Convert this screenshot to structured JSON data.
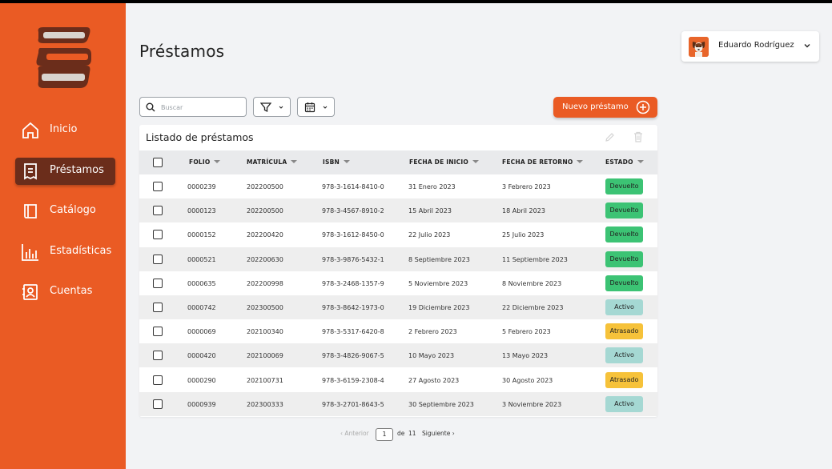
{
  "nav": {
    "items": [
      {
        "label": "Inicio",
        "icon": "home-icon"
      },
      {
        "label": "Préstamos",
        "icon": "receipt-icon",
        "active": true
      },
      {
        "label": "Catálogo",
        "icon": "book-icon"
      },
      {
        "label": "Estadísticas",
        "icon": "bar-chart-icon"
      },
      {
        "label": "Cuentas",
        "icon": "contact-card-icon"
      }
    ]
  },
  "header": {
    "title": "Préstamos"
  },
  "user": {
    "name": "Eduardo Rodríguez"
  },
  "toolbar": {
    "search_placeholder": "Buscar",
    "new_loan_label": "Nuevo préstamo"
  },
  "table": {
    "title": "Listado de préstamos",
    "columns": [
      "FOLIO",
      "MATRÍCULA",
      "ISBN",
      "FECHA DE INICIO",
      "FECHA DE RETORNO",
      "ESTADO"
    ],
    "rows": [
      {
        "folio": "0000239",
        "matricula": "202200500",
        "isbn": "978-3-1614-8410-0",
        "inicio": "31 Enero 2023",
        "retorno": "3 Febrero 2023",
        "estado": "Devuelto"
      },
      {
        "folio": "0000123",
        "matricula": "202200500",
        "isbn": "978-3-4567-8910-2",
        "inicio": "15 Abril 2023",
        "retorno": "18 Abril 2023",
        "estado": "Devuelto"
      },
      {
        "folio": "0000152",
        "matricula": "202200420",
        "isbn": "978-3-1612-8450-0",
        "inicio": "22 Julio 2023",
        "retorno": "25 Julio 2023",
        "estado": "Devuelto"
      },
      {
        "folio": "0000521",
        "matricula": "202200630",
        "isbn": "978-3-9876-5432-1",
        "inicio": "8 Septiembre 2023",
        "retorno": "11 Septiembre 2023",
        "estado": "Devuelto"
      },
      {
        "folio": "0000635",
        "matricula": "202200998",
        "isbn": "978-3-2468-1357-9",
        "inicio": "5 Noviembre 2023",
        "retorno": "8 Noviembre 2023",
        "estado": "Devuelto"
      },
      {
        "folio": "0000742",
        "matricula": "202300500",
        "isbn": "978-3-8642-1973-0",
        "inicio": "19 Diciembre 2023",
        "retorno": "22 Diciembre 2023",
        "estado": "Activo"
      },
      {
        "folio": "0000069",
        "matricula": "202100340",
        "isbn": "978-3-5317-6420-8",
        "inicio": "2 Febrero 2023",
        "retorno": "5 Febrero 2023",
        "estado": "Atrasado"
      },
      {
        "folio": "0000420",
        "matricula": "202100069",
        "isbn": "978-3-4826-9067-5",
        "inicio": "10 Mayo 2023",
        "retorno": "13 Mayo 2023",
        "estado": "Activo"
      },
      {
        "folio": "0000290",
        "matricula": "202100731",
        "isbn": "978-3-6159-2308-4",
        "inicio": "27 Agosto 2023",
        "retorno": "30 Agosto 2023",
        "estado": "Atrasado"
      },
      {
        "folio": "0000939",
        "matricula": "202300333",
        "isbn": "978-3-2701-8643-5",
        "inicio": "30 Septiembre 2023",
        "retorno": "3 Noviembre 2023",
        "estado": "Activo"
      }
    ]
  },
  "pagination": {
    "prev_label": "Anterior",
    "current_page": "1",
    "of_label": "de",
    "total_pages": "11",
    "next_label": "Siguiente"
  },
  "colors": {
    "accent": "#ea5b24",
    "active_nav": "#6b2d1b",
    "status_devuelto": "#3cc374",
    "status_activo": "#a5d8d3",
    "status_atrasado": "#f6c23a"
  }
}
